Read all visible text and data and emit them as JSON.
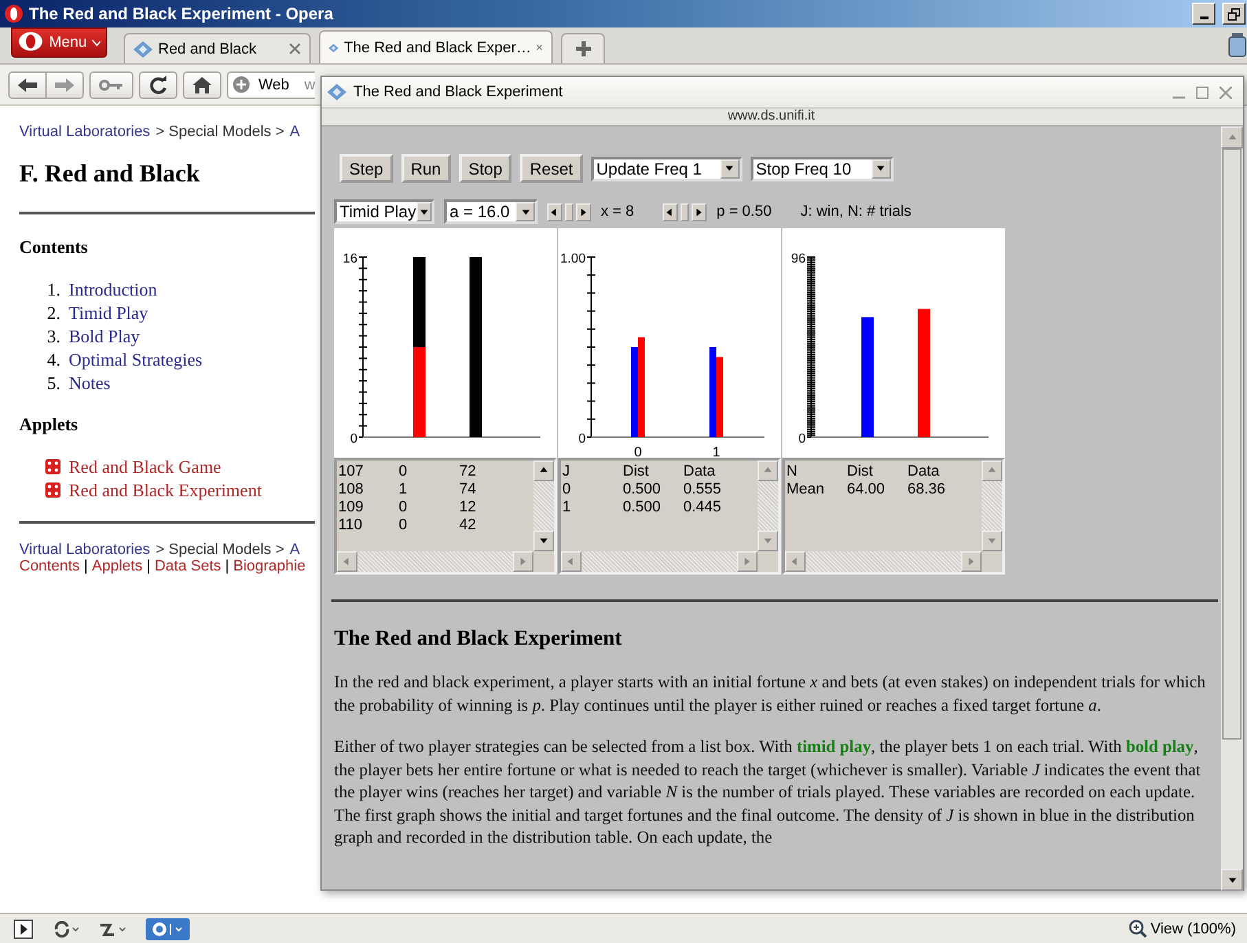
{
  "browser": {
    "title": "The Red and Black Experiment - Opera",
    "menu": "Menu",
    "tabs": [
      {
        "label": "Red and Black",
        "selected": false
      },
      {
        "label": "The Red and Black Exper…",
        "selected": true
      }
    ],
    "search_engine": "Web",
    "address": "w"
  },
  "page": {
    "breadcrumb": [
      {
        "kind": "link",
        "text": "Virtual Laboratories"
      },
      {
        "kind": "text",
        "text": "> Special Models >"
      },
      {
        "kind": "link",
        "text": "A"
      }
    ],
    "heading": "F. Red and Black",
    "contents_heading": "Contents",
    "contents": [
      {
        "number": "1.",
        "label": "Introduction"
      },
      {
        "number": "2.",
        "label": "Timid Play"
      },
      {
        "number": "3.",
        "label": "Bold Play"
      },
      {
        "number": "4.",
        "label": "Optimal Strategies"
      },
      {
        "number": "5.",
        "label": "Notes"
      }
    ],
    "applets_heading": "Applets",
    "applets": [
      "Red and Black Game",
      "Red and Black Experiment"
    ],
    "footer_breadcrumb": [
      {
        "kind": "link",
        "text": "Virtual Laboratories"
      },
      {
        "kind": "text",
        "text": "> Special Models >"
      },
      {
        "kind": "link",
        "text": "A"
      }
    ],
    "footer_links": [
      "Contents",
      "Applets",
      "Data Sets",
      "Biographie"
    ],
    "separator": "|"
  },
  "popup": {
    "title": "The Red and Black Experiment",
    "host": "www.ds.unifi.it",
    "toolbar": [
      {
        "kind": "button",
        "label": "Step"
      },
      {
        "kind": "button",
        "label": "Run"
      },
      {
        "kind": "button",
        "label": "Stop"
      },
      {
        "kind": "button",
        "label": "Reset"
      },
      {
        "kind": "dropdown",
        "value": "Update Freq 1"
      },
      {
        "kind": "dropdown",
        "value": "Stop Freq 10"
      }
    ],
    "parameters": [
      {
        "kind": "dropdown",
        "value": "Timid Play"
      },
      {
        "kind": "dropdown",
        "value": "a = 16.0"
      },
      {
        "kind": "scrollbar"
      },
      {
        "kind": "reading",
        "text": "x = 8"
      },
      {
        "kind": "scrollbar"
      },
      {
        "kind": "reading",
        "text": "p = 0.50"
      },
      {
        "kind": "reading",
        "text": "J: win, N: # trials"
      }
    ],
    "graphs": [
      {
        "chart_data": {
          "type": "bar",
          "stacked": true,
          "series": [
            {
              "color": "#ff0000",
              "values": [
                8,
                0
              ]
            },
            {
              "color": "#000000",
              "values": [
                8,
                16
              ]
            }
          ],
          "ylim": [
            0,
            16
          ],
          "yticks": [
            0,
            16
          ]
        },
        "table": {
          "rows": [
            [
              "107",
              "0",
              "72"
            ],
            [
              "108",
              "1",
              "74"
            ],
            [
              "109",
              "0",
              "12"
            ],
            [
              "110",
              "0",
              "42"
            ]
          ]
        }
      },
      {
        "chart_data": {
          "type": "bar",
          "categories": [
            "0",
            "1"
          ],
          "series": [
            {
              "color": "#0000ff",
              "values": [
                0.5,
                0.5
              ]
            },
            {
              "color": "#ff0000",
              "values": [
                0.555,
                0.445
              ]
            }
          ],
          "ylim": [
            0,
            1
          ],
          "yticks": [
            0,
            {
              "value": 1,
              "label": "1.00"
            }
          ]
        },
        "table": {
          "rows": [
            [
              "J",
              "Dist",
              "Data"
            ],
            [
              "0",
              "0.500",
              "0.555"
            ],
            [
              "1",
              "0.500",
              "0.445"
            ]
          ]
        }
      },
      {
        "chart_data": {
          "type": "bar",
          "series": [
            {
              "color": "#0000ff",
              "values": [
                64
              ]
            },
            {
              "color": "#ff0000",
              "values": [
                68.36
              ]
            }
          ],
          "ylim": [
            0,
            96
          ],
          "yticks": [
            0,
            96
          ]
        },
        "table": {
          "rows": [
            [
              "N",
              "Dist",
              "Data"
            ],
            [
              "Mean",
              "64.00",
              "68.36"
            ]
          ]
        }
      }
    ],
    "article": {
      "heading": "The Red and Black Experiment",
      "paragraphs": [
        "In the red and black experiment, a player starts with an initial fortune *x* and bets (at even stakes) on independent trials for which the probability of winning is *p*. Play continues until the player is either ruined or reaches a fixed target fortune *a*.",
        "Either of two player strategies can be selected from a list box. With **timid play**, the player bets 1 on each trial. With **bold play**, the player bets her entire fortune or what is needed to reach the target (whichever is smaller). Variable *J* indicates the event that the player wins (reaches her target) and variable *N* is the number of trials played. These variables are recorded on each update. The first graph shows the initial and target fortunes and the final outcome. The density of *J* is shown in blue in the distribution graph and recorded in the distribution table. On each update, the"
      ]
    }
  },
  "status_bar": {
    "zoom": "View (100%)"
  }
}
